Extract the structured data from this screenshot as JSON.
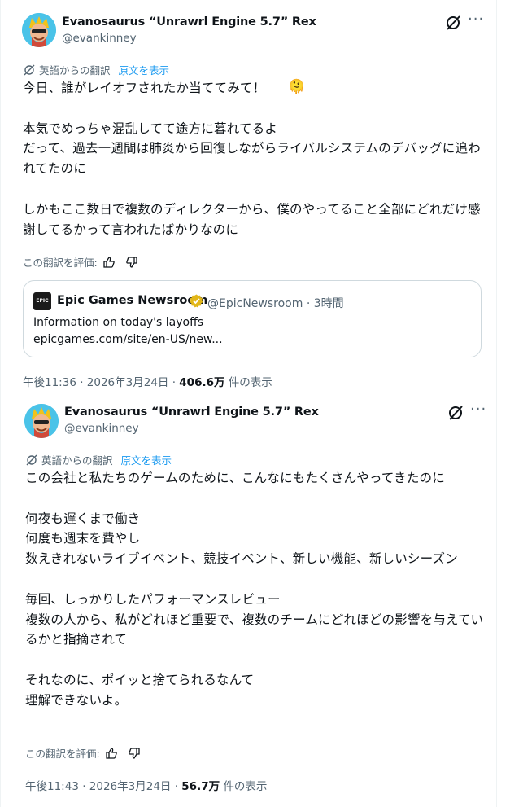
{
  "post1": {
    "display_name": "Evanosaurus “Unrawrl Engine 5.7” Rex",
    "handle": "@evankinney",
    "translated_label": "英語からの翻訳",
    "show_original": "原文を表示",
    "body": "今日、誰がレイオフされたか当ててみて！\n\n本気でめっちゃ混乱してて途方に暮れてるよ\nだって、過去一週間は肺炎から回復しながらライバルシステムのデバッグに追われてたのに\n\nしかもここ数日で複数のディレクターから、僕のやってること全部にどれだけ感謝してるかって言われたばかりなのに",
    "emoji": "🫠",
    "rate_label": "この翻訳を評価:",
    "quote": {
      "logo_text": "EPIC",
      "name": "Epic Games Newsroom",
      "handle": "@EpicNewsroom · 3時間",
      "title": "Information on today's layoffs",
      "link": "epicgames.com/site/en-US/new..."
    },
    "time": "午後11:36 · 2026年3月24日 · ",
    "views": "406.6万",
    "views_suffix": " 件の表示"
  },
  "post2": {
    "display_name": "Evanosaurus “Unrawrl Engine 5.7” Rex",
    "handle": "@evankinney",
    "translated_label": "英語からの翻訳",
    "show_original": "原文を表示",
    "body": "この会社と私たちのゲームのために、こんなにもたくさんやってきたのに\n\n何夜も遅くまで働き\n何度も週末を費やし\n数えきれないライブイベント、競技イベント、新しい機能、新しいシーズン\n\n毎回、しっかりしたパフォーマンスレビュー\n複数の人から、私がどれほど重要で、複数のチームにどれほどの影響を与えているかと指摘されて\n\nそれなのに、ポイッと捨てられるなんて\n理解できないよ。",
    "rate_label": "この翻訳を評価:",
    "time": "午後11:43 · 2026年3月24日 · ",
    "views": "56.7万",
    "views_suffix": " 件の表示"
  },
  "colors": {
    "accent": "#1d9bf0",
    "secondary_text": "#536471",
    "primary_text": "#0f1419",
    "border": "#cfd9de",
    "verified": "#e2b719"
  },
  "icons": [
    "grok-icon",
    "more-icon",
    "translate-icon",
    "thumbs-up-icon",
    "thumbs-down-icon",
    "verified-gold-icon",
    "epic-logo"
  ]
}
